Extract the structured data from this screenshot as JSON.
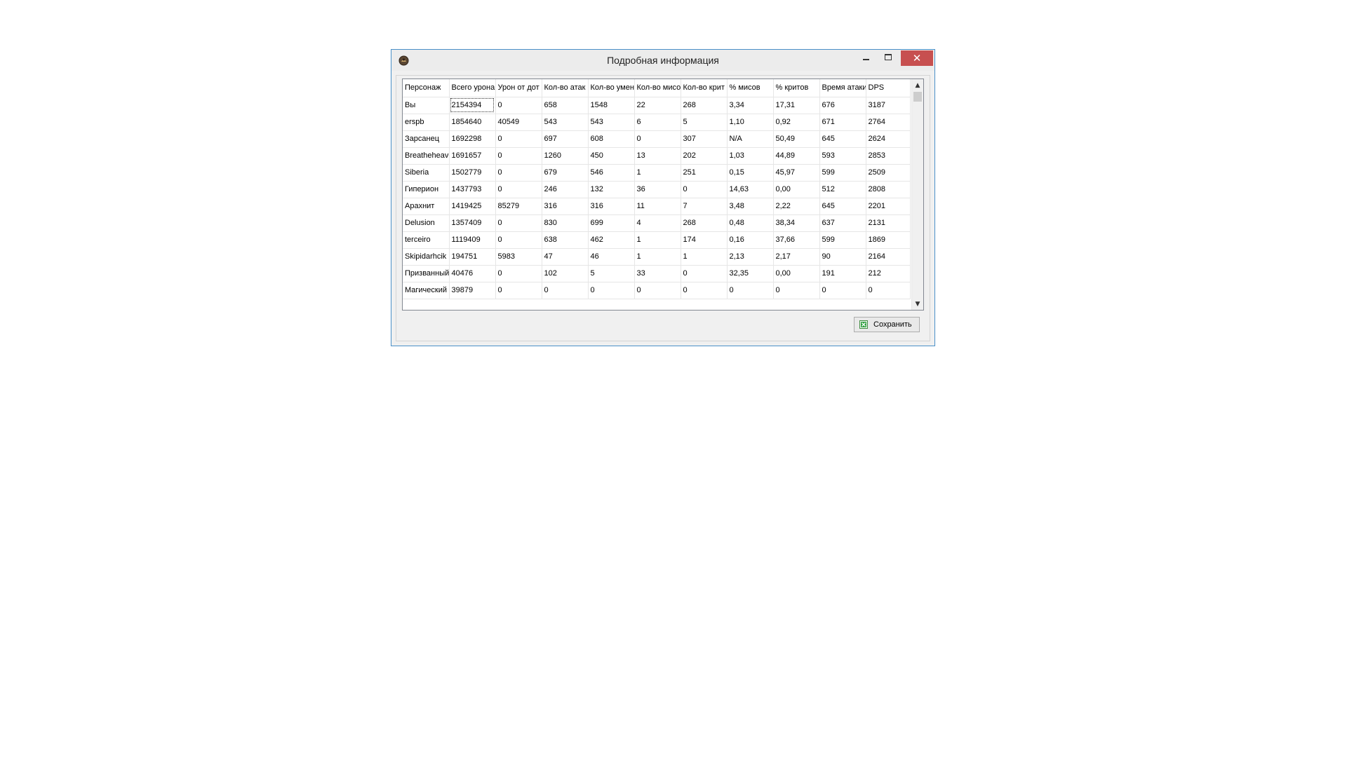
{
  "window": {
    "title": "Подробная информация",
    "close_glyph": "✕"
  },
  "colors": {
    "close_button": "#c75050",
    "window_border": "#4a90c8"
  },
  "table": {
    "columns": [
      "Персонаж",
      "Всего урона",
      "Урон от дот",
      "Кол-во атак",
      "Кол-во умен",
      "Кол-во мисов",
      "Кол-во крит",
      "% мисов",
      "% критов",
      "Время атаки",
      "DPS"
    ],
    "rows": [
      [
        "Вы",
        "2154394",
        "0",
        "658",
        "1548",
        "22",
        "268",
        "3,34",
        "17,31",
        "676",
        "3187"
      ],
      [
        "erspb",
        "1854640",
        "40549",
        "543",
        "543",
        "6",
        "5",
        "1,10",
        "0,92",
        "671",
        "2764"
      ],
      [
        "Зарсанец",
        "1692298",
        "0",
        "697",
        "608",
        "0",
        "307",
        "N/A",
        "50,49",
        "645",
        "2624"
      ],
      [
        "Breatheheaven",
        "1691657",
        "0",
        "1260",
        "450",
        "13",
        "202",
        "1,03",
        "44,89",
        "593",
        "2853"
      ],
      [
        "Siberia",
        "1502779",
        "0",
        "679",
        "546",
        "1",
        "251",
        "0,15",
        "45,97",
        "599",
        "2509"
      ],
      [
        "Гиперион",
        "1437793",
        "0",
        "246",
        "132",
        "36",
        "0",
        "14,63",
        "0,00",
        "512",
        "2808"
      ],
      [
        "Арахнит",
        "1419425",
        "85279",
        "316",
        "316",
        "11",
        "7",
        "3,48",
        "2,22",
        "645",
        "2201"
      ],
      [
        "Delusion",
        "1357409",
        "0",
        "830",
        "699",
        "4",
        "268",
        "0,48",
        "38,34",
        "637",
        "2131"
      ],
      [
        "terceiro",
        "1119409",
        "0",
        "638",
        "462",
        "1",
        "174",
        "0,16",
        "37,66",
        "599",
        "1869"
      ],
      [
        "Skipidarhcik",
        "194751",
        "5983",
        "47",
        "46",
        "1",
        "1",
        "2,13",
        "2,17",
        "90",
        "2164"
      ],
      [
        "Призванный",
        "40476",
        "0",
        "102",
        "5",
        "33",
        "0",
        "32,35",
        "0,00",
        "191",
        "212"
      ],
      [
        "Магический",
        "39879",
        "0",
        "0",
        "0",
        "0",
        "0",
        "0",
        "0",
        "0",
        "0"
      ]
    ]
  },
  "scrollbar": {
    "up_glyph": "▲",
    "down_glyph": "▼"
  },
  "footer": {
    "save_label": "Сохранить"
  }
}
